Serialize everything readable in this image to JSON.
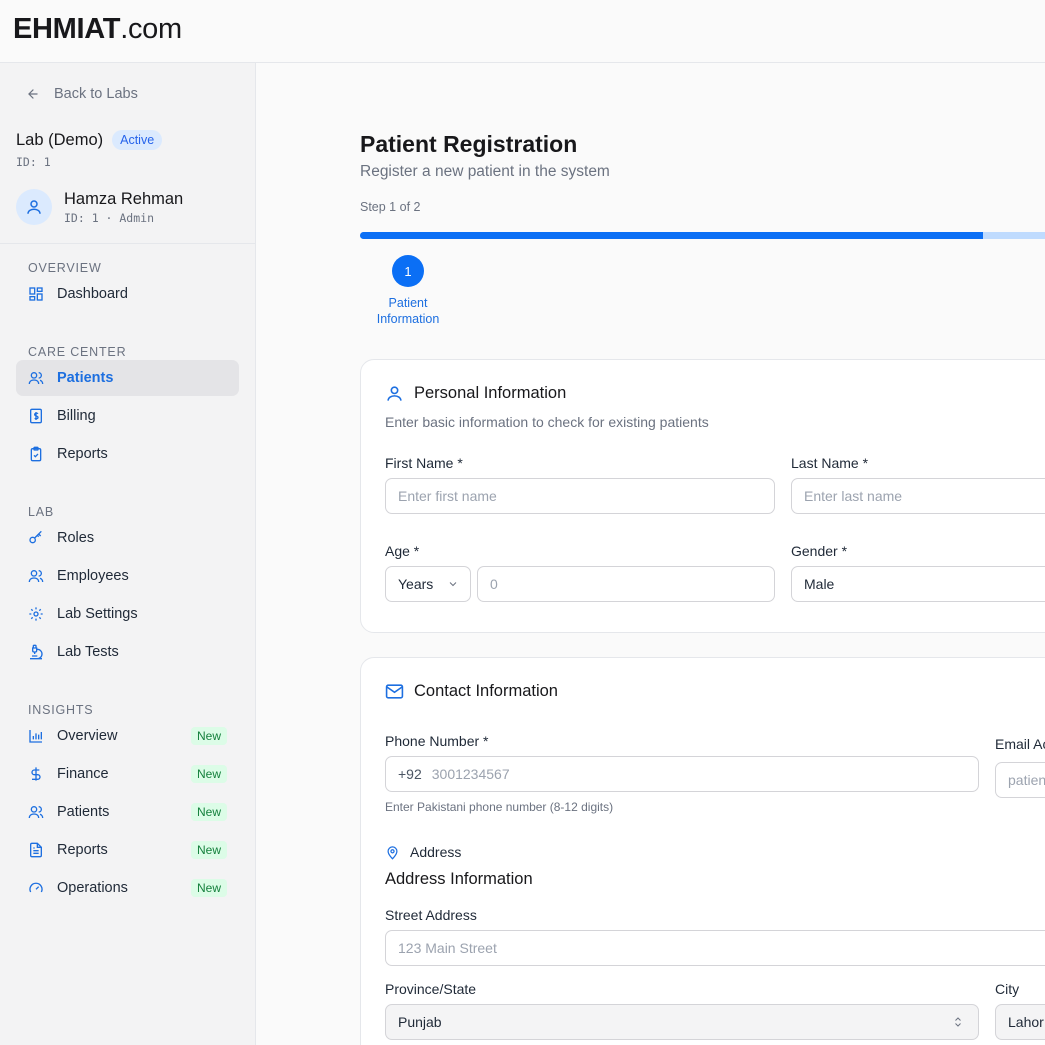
{
  "app": {
    "logo_bold": "EHMIAT",
    "logo_rest": ".com"
  },
  "sidebar": {
    "back_label": "Back to Labs",
    "lab_name": "Lab (Demo)",
    "lab_status": "Active",
    "lab_id": "ID: 1",
    "user_name": "Hamza Rehman",
    "user_meta": "ID: 1 · Admin",
    "sections": {
      "overview": "OVERVIEW",
      "care": "CARE CENTER",
      "lab": "LAB",
      "insights": "INSIGHTS"
    },
    "items": {
      "dashboard": "Dashboard",
      "patients": "Patients",
      "billing": "Billing",
      "reports": "Reports",
      "roles": "Roles",
      "employees": "Employees",
      "lab_settings": "Lab Settings",
      "lab_tests": "Lab Tests",
      "ins_overview": "Overview",
      "ins_finance": "Finance",
      "ins_patients": "Patients",
      "ins_reports": "Reports",
      "ins_operations": "Operations"
    },
    "new_badge": "New"
  },
  "page": {
    "title": "Patient Registration",
    "subtitle": "Register a new patient in the system",
    "step_text": "Step 1 of 2",
    "progress": 0.89,
    "step_number": "1",
    "step_label": "Patient Information"
  },
  "personal": {
    "title": "Personal Information",
    "desc": "Enter basic information to check for existing patients",
    "first_name_label": "First Name *",
    "first_name_placeholder": "Enter first name",
    "last_name_label": "Last Name *",
    "last_name_placeholder": "Enter last name",
    "age_label": "Age *",
    "age_unit": "Years",
    "age_placeholder": "0",
    "gender_label": "Gender *",
    "gender_value": "Male"
  },
  "contact": {
    "title": "Contact Information",
    "phone_label": "Phone Number *",
    "phone_prefix": "+92",
    "phone_placeholder": "3001234567",
    "phone_hint": "Enter Pakistani phone number (8-12 digits)",
    "email_label": "Email Ac",
    "email_placeholder": "patien",
    "address_label": "Address",
    "address_heading": "Address Information",
    "street_label": "Street Address",
    "street_placeholder": "123 Main Street",
    "province_label": "Province/State",
    "province_value": "Punjab",
    "city_label": "City",
    "city_value": "Lahor"
  },
  "colors": {
    "accent": "#0b6ff5",
    "new_badge_bg": "#dcfce7",
    "new_badge_fg": "#15803d"
  }
}
